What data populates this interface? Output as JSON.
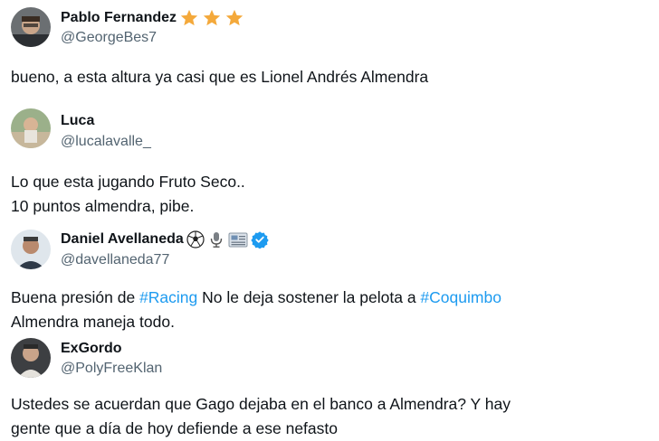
{
  "tweets": [
    {
      "name": "Pablo Fernandez",
      "handle": "@GeorgeBes7",
      "name_badges": [
        "star-icon",
        "star-icon",
        "star-icon"
      ],
      "text_lines": [
        "bueno, a esta altura ya casi que es Lionel Andrés Almendra"
      ]
    },
    {
      "name": "Luca",
      "handle": "@lucalavalle_",
      "text_lines": [
        "Lo que esta jugando Fruto Seco..",
        "10 puntos almendra, pibe."
      ]
    },
    {
      "name": "Daniel Avellaneda",
      "handle": "@davellaneda77",
      "name_badges": [
        "soccer-ball-icon",
        "microphone-icon",
        "newspaper-icon",
        "verified-badge-icon"
      ],
      "text_segments": [
        {
          "text": "Buena presión de "
        },
        {
          "text": "#Racing",
          "hashtag": true
        },
        {
          "text": " No le deja sostener la pelota a "
        },
        {
          "text": "#Coquimbo",
          "hashtag": true
        }
      ],
      "text_line2": "Almendra maneja todo."
    },
    {
      "name": "ExGordo",
      "handle": "@PolyFreeKlan",
      "text_lines": [
        "Ustedes se acuerdan que Gago dejaba en el banco a Almendra? Y hay",
        "gente que a día de hoy defiende a ese nefasto"
      ]
    }
  ],
  "colors": {
    "text": "#0f1419",
    "secondary": "#536471",
    "hashtag": "#1d9bf0",
    "star": "#f4a93b",
    "verified": "#1d9bf0"
  }
}
